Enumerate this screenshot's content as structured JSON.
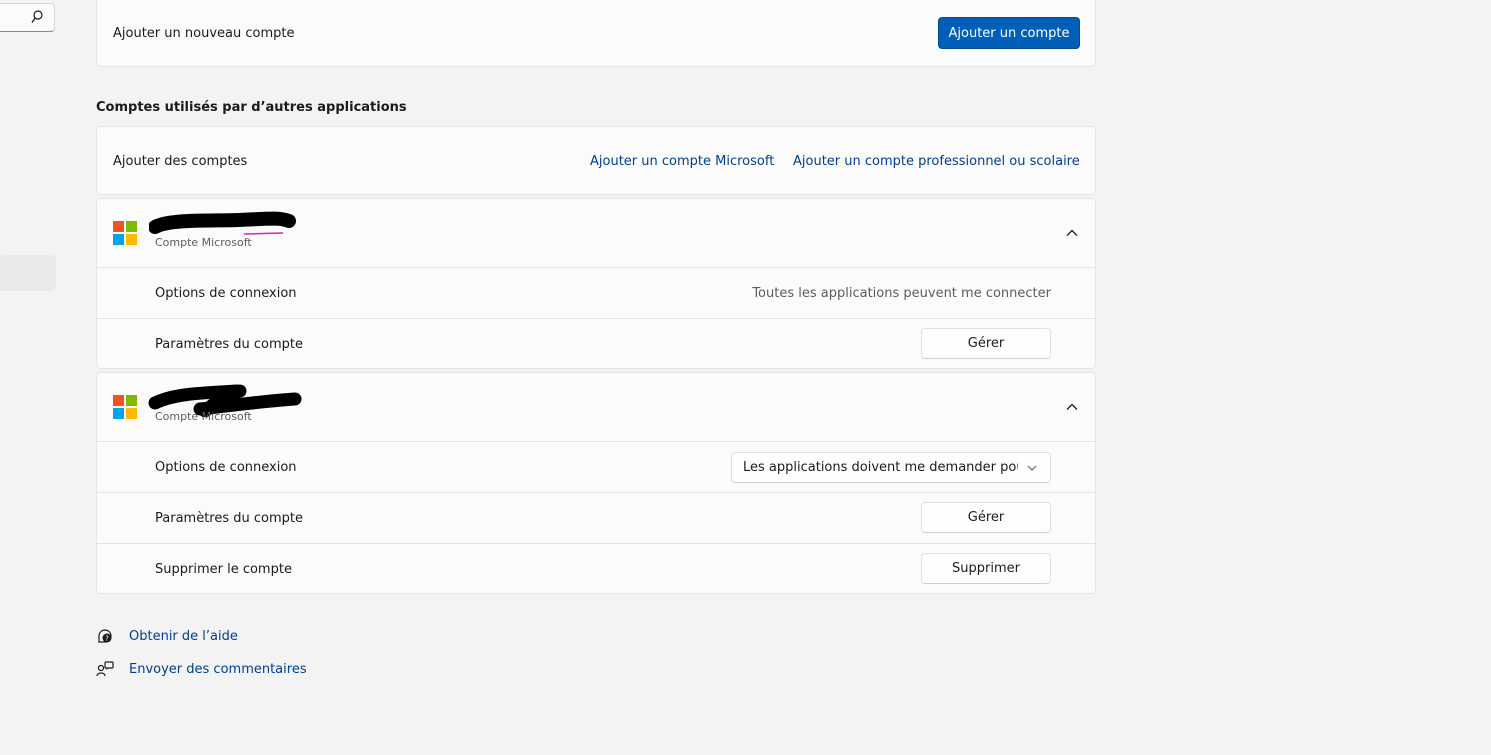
{
  "search": {
    "icon": "search-icon"
  },
  "add_new": {
    "label": "Ajouter un nouveau compte",
    "button": "Ajouter un compte"
  },
  "section_title": "Comptes utilisés par d’autres applications",
  "add_accounts": {
    "label": "Ajouter des comptes",
    "link_microsoft": "Ajouter un compte Microsoft",
    "link_work": "Ajouter un compte professionnel ou scolaire"
  },
  "accounts": [
    {
      "type": "Compte Microsoft",
      "signin_label": "Options de connexion",
      "signin_value": "Toutes les applications peuvent me connecter",
      "settings_label": "Paramètres du compte",
      "settings_button": "Gérer"
    },
    {
      "type": "Compte Microsoft",
      "signin_label": "Options de connexion",
      "signin_value": "Les applications doivent me demander pour",
      "settings_label": "Paramètres du compte",
      "settings_button": "Gérer",
      "remove_label": "Supprimer le compte",
      "remove_button": "Supprimer"
    }
  ],
  "footer": {
    "help": "Obtenir de l’aide",
    "feedback": "Envoyer des commentaires"
  },
  "colors": {
    "accent": "#005fb8",
    "link": "#003e92",
    "ms_red": "#f25022",
    "ms_green": "#7fba00",
    "ms_blue": "#00a4ef",
    "ms_yellow": "#ffb900"
  }
}
